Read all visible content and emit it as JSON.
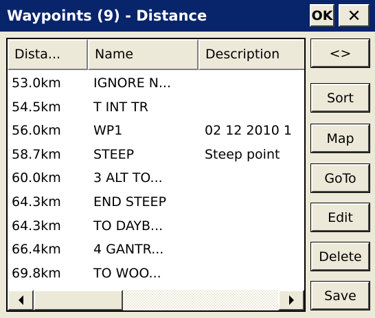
{
  "window": {
    "title": "Waypoints (9) - Distance",
    "ok_label": "OK",
    "close_label": "✕"
  },
  "list": {
    "columns": [
      "Dista...",
      "Name",
      "Description"
    ],
    "rows": [
      {
        "distance": "53.0km",
        "name": "IGNORE N...",
        "description": ""
      },
      {
        "distance": "54.5km",
        "name": "T INT TR",
        "description": ""
      },
      {
        "distance": "56.0km",
        "name": "WP1",
        "description": "02 12 2010 1"
      },
      {
        "distance": "58.7km",
        "name": "STEEP",
        "description": "Steep point"
      },
      {
        "distance": "60.0km",
        "name": "3 ALT TO...",
        "description": ""
      },
      {
        "distance": "64.3km",
        "name": "END STEEP",
        "description": ""
      },
      {
        "distance": "64.3km",
        "name": "TO DAYB...",
        "description": ""
      },
      {
        "distance": "66.4km",
        "name": "4 GANTR...",
        "description": ""
      },
      {
        "distance": "69.8km",
        "name": "TO WOO...",
        "description": ""
      }
    ]
  },
  "buttons": {
    "swap": "<>",
    "sort": "Sort",
    "map": "Map",
    "goto": "GoTo",
    "edit": "Edit",
    "delete": "Delete",
    "save": "Save"
  },
  "icons": {
    "scroll_left": "triangle-left",
    "scroll_right": "triangle-right"
  },
  "colors": {
    "titlebar": "#08246b",
    "face": "#ece9d8",
    "list_bg": "#ffffff"
  }
}
